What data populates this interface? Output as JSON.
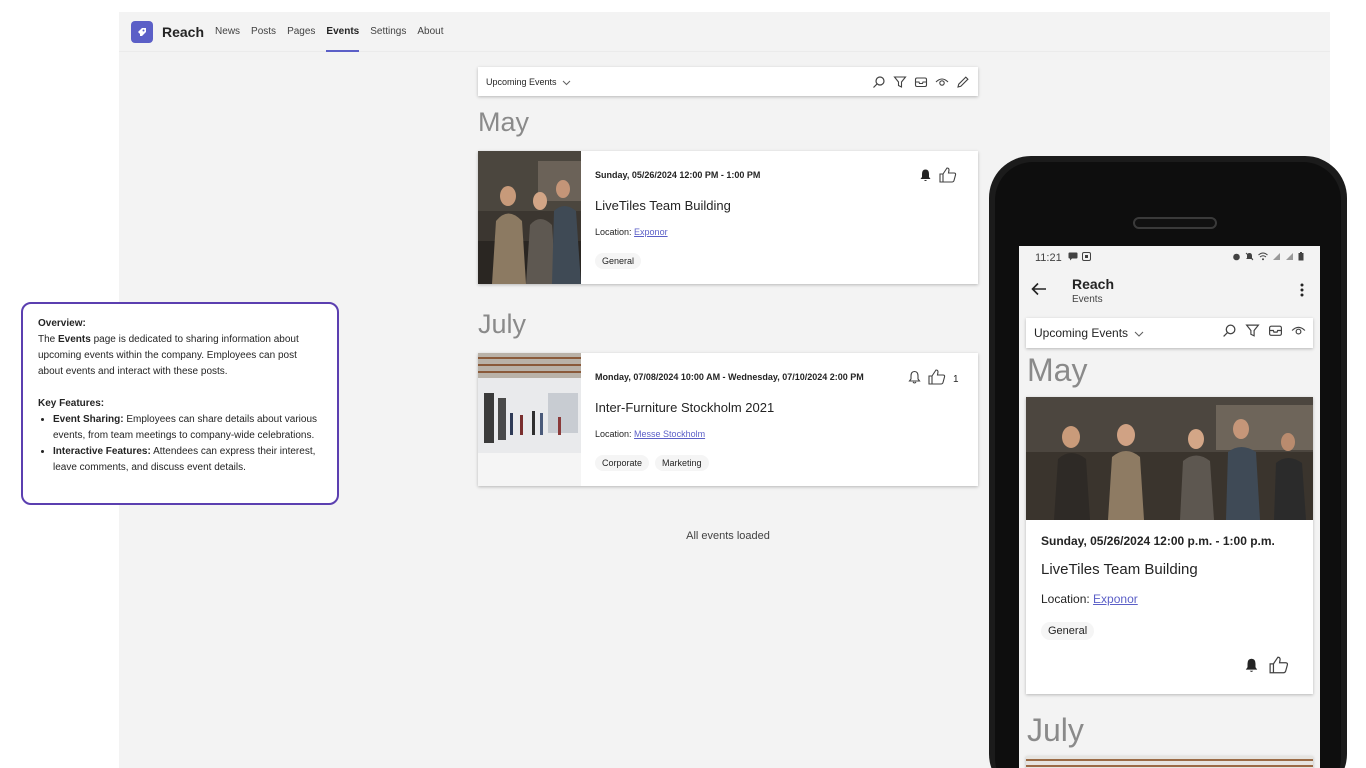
{
  "app": {
    "title": "Reach",
    "nav": [
      {
        "label": "News",
        "active": false
      },
      {
        "label": "Posts",
        "active": false
      },
      {
        "label": "Pages",
        "active": false
      },
      {
        "label": "Events",
        "active": true
      },
      {
        "label": "Settings",
        "active": false
      },
      {
        "label": "About",
        "active": false
      }
    ],
    "accent_color": "#5b5fc7"
  },
  "toolbar": {
    "view_label": "Upcoming Events",
    "tools": [
      "search-icon",
      "filter-icon",
      "mail-icon",
      "eye-icon",
      "edit-icon"
    ]
  },
  "months": [
    "May",
    "July"
  ],
  "events": [
    {
      "date": "Sunday, 05/26/2024 12:00 PM - 1:00 PM",
      "title": "LiveTiles Team Building",
      "location_label": "Location:",
      "location": "Exponor",
      "tags": [
        "General"
      ],
      "like_count": "",
      "bell_filled": true
    },
    {
      "date": "Monday, 07/08/2024 10:00 AM - Wednesday, 07/10/2024 2:00 PM",
      "title": "Inter-Furniture Stockholm 2021",
      "location_label": "Location:",
      "location": "Messe Stockholm",
      "tags": [
        "Corporate",
        "Marketing"
      ],
      "like_count": "1",
      "bell_filled": false
    }
  ],
  "status": "All events loaded",
  "overview": {
    "heading": "Overview:",
    "intro_pre": "The",
    "intro_bold": "Events",
    "intro_post": "page is dedicated to sharing information about upcoming events within the company. Employees can post about events and interact with these posts.",
    "features_heading": "Key Features:",
    "features": [
      {
        "name": "Event Sharing:",
        "text": "Employees can share details about various events, from team meetings to company-wide celebrations."
      },
      {
        "name": "Interactive Features:",
        "text": "Attendees can express their interest, leave comments, and discuss event details."
      }
    ]
  },
  "mobile": {
    "time": "11:21",
    "title": "Reach",
    "subtitle": "Events",
    "view_label": "Upcoming Events",
    "months": [
      "May",
      "July"
    ],
    "event": {
      "date": "Sunday, 05/26/2024 12:00 p.m. - 1:00 p.m.",
      "title": "LiveTiles Team Building",
      "location_label": "Location:",
      "location": "Exponor",
      "tag": "General"
    }
  }
}
